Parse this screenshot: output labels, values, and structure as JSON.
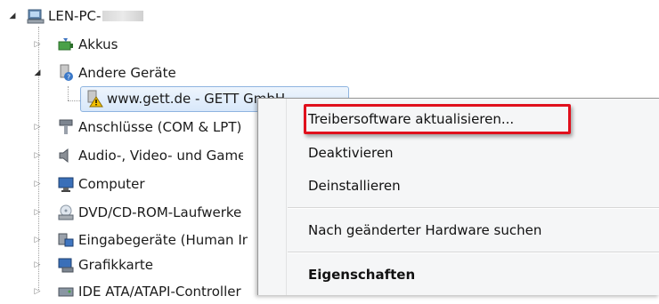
{
  "tree": {
    "root": {
      "label": "LEN-PC-",
      "icon": "computer-icon"
    },
    "items": [
      {
        "label": "Akkus",
        "icon": "battery-icon"
      },
      {
        "label": "Andere Geräte",
        "icon": "unknown-device-icon"
      },
      {
        "label": "www.gett.de - GETT GmbH",
        "icon": "warning-device-icon"
      },
      {
        "label": "Anschlüsse (COM & LPT)",
        "icon": "port-icon"
      },
      {
        "label": "Audio-, Video- und Gamecontroller",
        "icon": "speaker-icon"
      },
      {
        "label": "Computer",
        "icon": "monitor-icon"
      },
      {
        "label": "DVD/CD-ROM-Laufwerke",
        "icon": "dvd-drive-icon"
      },
      {
        "label": "Eingabegeräte (Human Interface Devices)",
        "icon": "input-device-icon"
      },
      {
        "label": "Grafikkarte",
        "icon": "display-adapter-icon"
      },
      {
        "label": "IDE ATA/ATAPI-Controller",
        "icon": "ide-controller-icon"
      }
    ]
  },
  "context_menu": {
    "items": [
      {
        "label": "Treibersoftware aktualisieren..."
      },
      {
        "label": "Deaktivieren"
      },
      {
        "label": "Deinstallieren"
      },
      {
        "label": "Nach geänderter Hardware suchen"
      },
      {
        "label": "Eigenschaften"
      }
    ],
    "highlight_color": "#e0101c"
  }
}
